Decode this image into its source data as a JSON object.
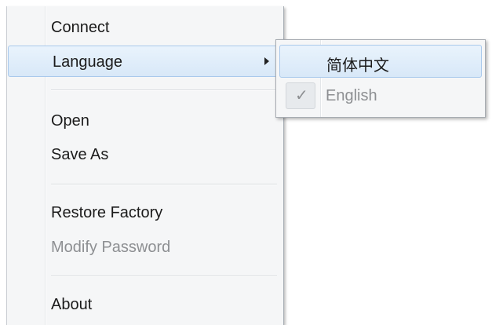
{
  "menu": {
    "items": [
      {
        "label": "Connect"
      },
      {
        "label": "Language"
      },
      {
        "label": "Open"
      },
      {
        "label": "Save As"
      },
      {
        "label": "Restore Factory"
      },
      {
        "label": "Modify Password"
      },
      {
        "label": "About"
      }
    ]
  },
  "submenu": {
    "items": [
      {
        "label": "简体中文"
      },
      {
        "label": "English",
        "check": "✓"
      }
    ]
  },
  "colors": {
    "highlight": "#d8e8f8",
    "highlight_border": "#a9c9ec",
    "disabled_text": "#8d8f92"
  }
}
